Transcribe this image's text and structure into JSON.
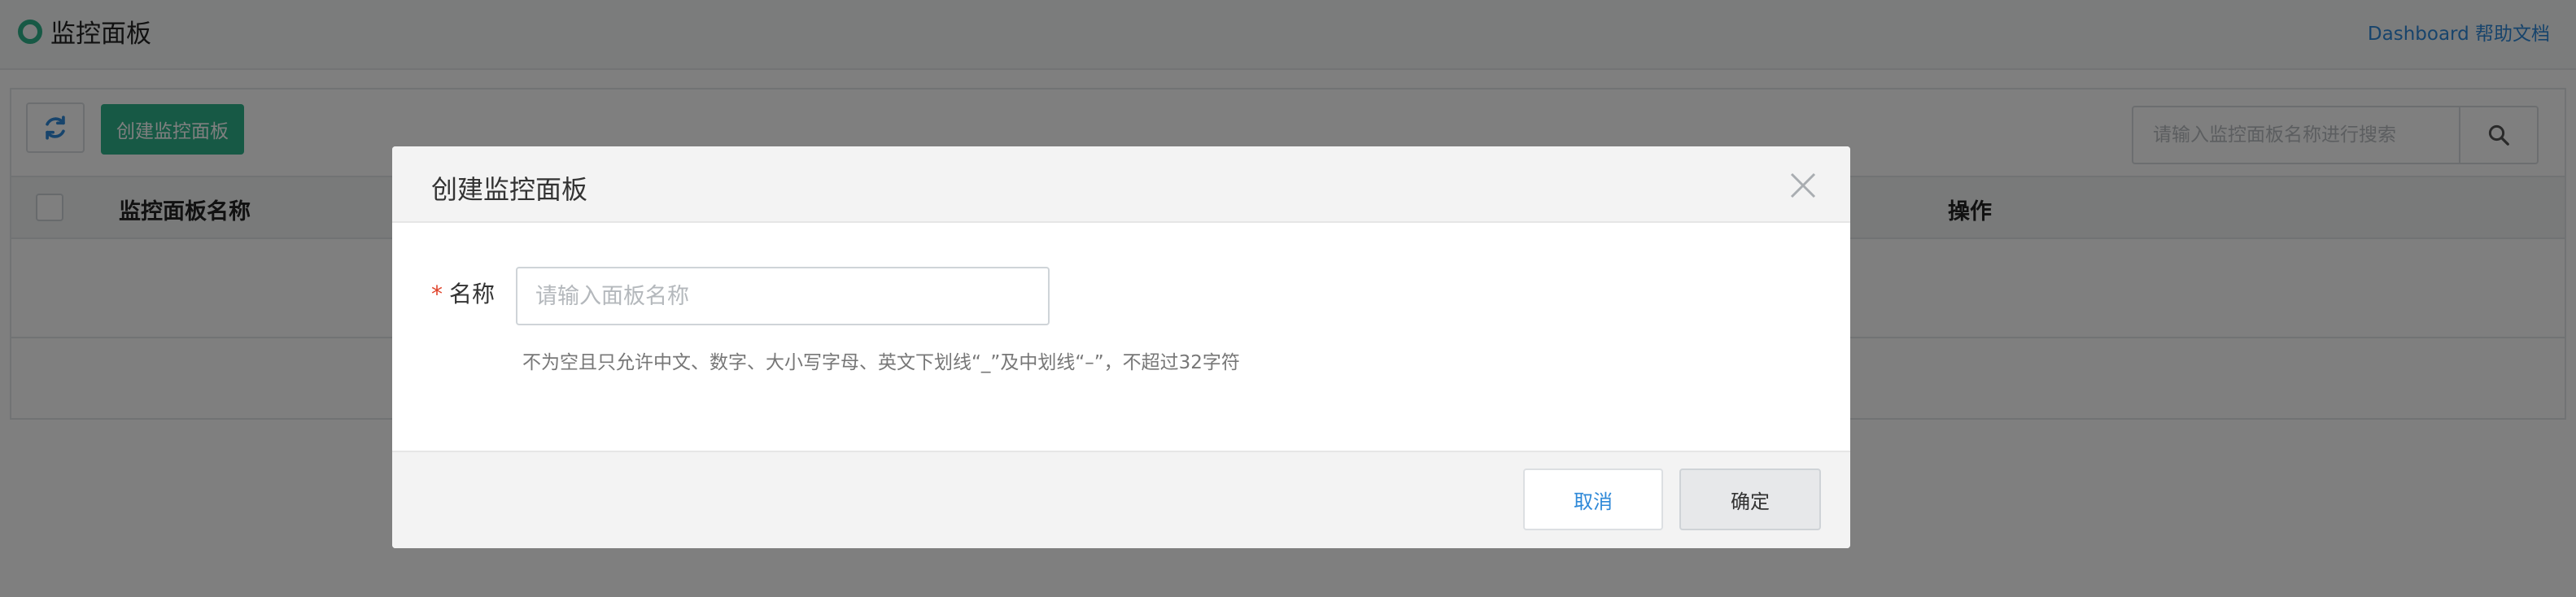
{
  "header": {
    "title": "监控面板",
    "help_link": "Dashboard 帮助文档"
  },
  "toolbar": {
    "create_label": "创建监控面板",
    "search_placeholder": "请输入监控面板名称进行搜索"
  },
  "table": {
    "columns": [
      "监控面板名称",
      "操作"
    ]
  },
  "modal": {
    "title": "创建监控面板",
    "required_mark": "*",
    "name_label": "名称",
    "name_placeholder": "请输入面板名称",
    "name_value": "",
    "hint": "不为空且只允许中文、数字、大小写字母、英文下划线“_”及中划线“–”，不超过32字符",
    "cancel_label": "取消",
    "ok_label": "确定"
  },
  "colors": {
    "brand": "#2fb38a",
    "link": "#2f89d8",
    "required": "#e0442b"
  },
  "icons": {
    "logo": "ring-logo-icon",
    "refresh": "refresh-icon",
    "search": "search-icon",
    "close": "close-icon"
  }
}
